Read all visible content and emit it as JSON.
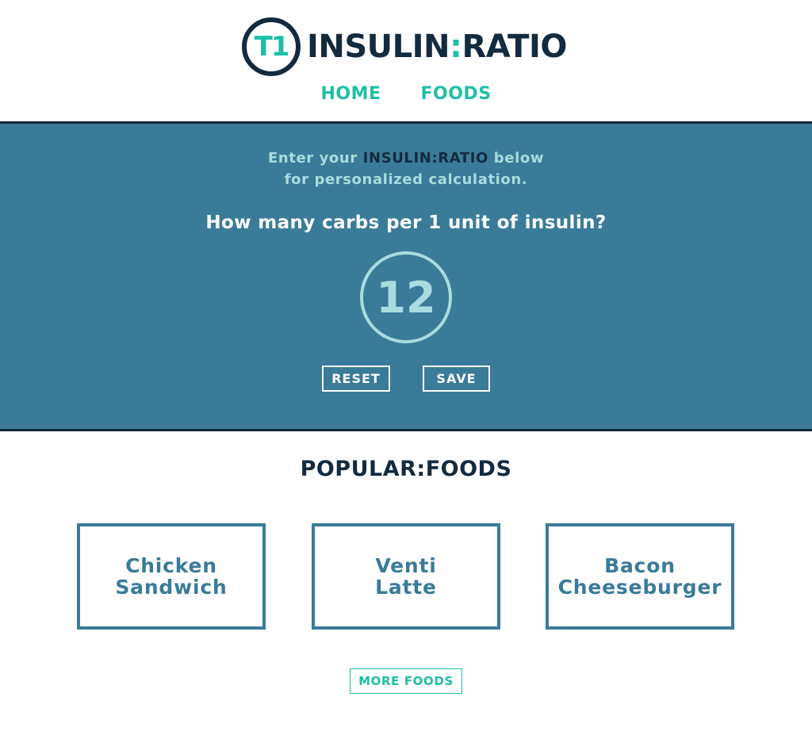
{
  "logo": {
    "mark": "T1",
    "text_left": "INSULIN",
    "text_colon": ":",
    "text_right": "RATIO"
  },
  "nav": {
    "items": [
      {
        "label": "HOME"
      },
      {
        "label": "FOODS"
      }
    ]
  },
  "calculator": {
    "intro_prefix": "Enter your ",
    "intro_brand": "INSULIN:RATIO",
    "intro_suffix": " below",
    "intro_line2": "for personalized calculation.",
    "question": "How many carbs per 1 unit of insulin?",
    "ratio_value": "12",
    "reset_label": "RESET",
    "save_label": "SAVE"
  },
  "popular": {
    "title": "POPULAR:FOODS",
    "foods": [
      {
        "line1": "Chicken",
        "line2": "Sandwich"
      },
      {
        "line1": "Venti",
        "line2": "Latte"
      },
      {
        "line1": "Bacon",
        "line2": "Cheeseburger"
      }
    ],
    "more_label": "MORE FOODS"
  },
  "colors": {
    "brand_navy": "#142a3e",
    "accent_teal": "#1fbfa6",
    "band_blue": "#3a7b99",
    "light_aqua": "#a9dcdf"
  }
}
